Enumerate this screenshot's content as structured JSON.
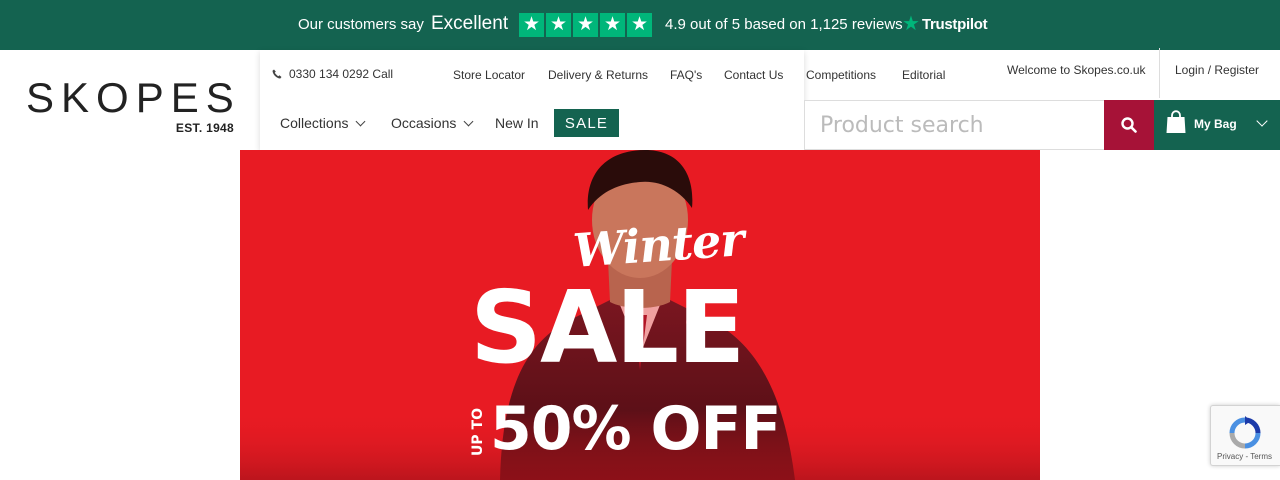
{
  "trustpilot": {
    "customers_say": "Our customers say",
    "rating_word": "Excellent",
    "stars": 5,
    "rating_text": "4.9 out of 5 based on 1,125 reviews",
    "brand": "Trustpilot"
  },
  "logo": {
    "name": "SKOPES",
    "est": "EST. 1948"
  },
  "header": {
    "phone": "0330 134 0292 Call",
    "top_links": [
      "Store Locator",
      "Delivery & Returns",
      "FAQ's",
      "Contact Us",
      "Competitions",
      "Editorial"
    ],
    "main_nav": [
      "Collections",
      "Occasions",
      "New In"
    ],
    "sale_label": "SALE",
    "welcome": "Welcome to Skopes.co.uk",
    "login": "Login / Register"
  },
  "search": {
    "placeholder": "Product search"
  },
  "bag": {
    "label": "My Bag"
  },
  "hero": {
    "script_title": "Winter",
    "headline": "SALE",
    "up_to": "UP TO",
    "discount": "50% OFF"
  },
  "recaptcha": {
    "privacy": "Privacy",
    "terms": "Terms"
  },
  "colors": {
    "brand_green": "#146350",
    "trustpilot_green": "#00b67a",
    "search_button": "#a61237",
    "hero_red": "#e81b23"
  }
}
